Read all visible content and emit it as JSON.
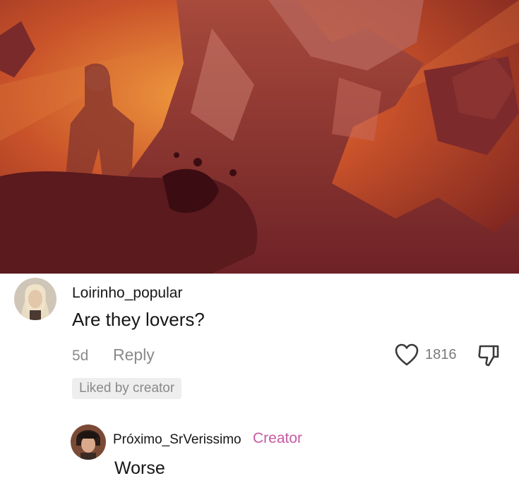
{
  "artwork": {
    "icon": "dark-fantasy-illustration"
  },
  "comment": {
    "username": "Loirinho_popular",
    "text": "Are they lovers?",
    "time": "5d",
    "reply_label": "Reply",
    "like_count": "1816",
    "liked_badge": "Liked by creator"
  },
  "reply": {
    "username": "Próximo_SrVerissimo",
    "badge": "Creator",
    "text": "Worse"
  },
  "colors": {
    "badge_pink": "#c65aa2",
    "muted_text": "#8a8a8a"
  }
}
